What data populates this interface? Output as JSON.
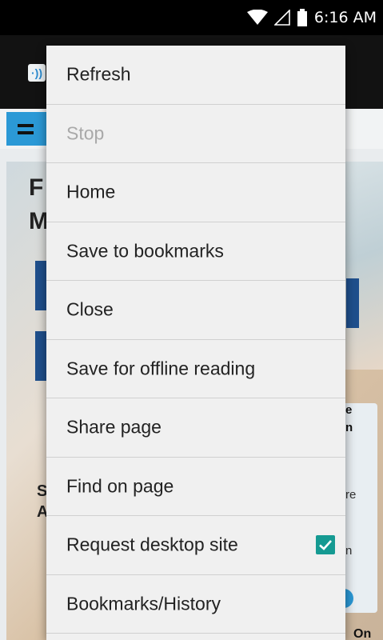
{
  "status_bar": {
    "time": "6:16 AM",
    "icons": [
      "wifi-icon",
      "signal-icon",
      "battery-icon"
    ]
  },
  "app": {
    "logo_icon": "signal-wave-icon"
  },
  "page_behind": {
    "hamburger_icon": "menu-icon",
    "fragments": {
      "title_char1": "F",
      "title_char2": "M",
      "left_a": "S",
      "left_b": "A",
      "card_l1": "e",
      "card_l2": "n",
      "card_s1": "re",
      "card_s2": "n",
      "bottom_right": "On"
    }
  },
  "menu": {
    "items": [
      {
        "label": "Refresh",
        "enabled": true
      },
      {
        "label": "Stop",
        "enabled": false
      },
      {
        "label": "Home",
        "enabled": true
      },
      {
        "label": "Save to bookmarks",
        "enabled": true
      },
      {
        "label": "Close",
        "enabled": true
      },
      {
        "label": "Save for offline reading",
        "enabled": true
      },
      {
        "label": "Share page",
        "enabled": true
      },
      {
        "label": "Find on page",
        "enabled": true
      },
      {
        "label": "Request desktop site",
        "enabled": true,
        "checked": true
      },
      {
        "label": "Bookmarks/History",
        "enabled": true
      }
    ]
  },
  "colors": {
    "accent": "#2b99d6",
    "checkbox": "#159a92",
    "menu_background": "#f0f0f0",
    "disabled_text": "#a9a9a9"
  }
}
